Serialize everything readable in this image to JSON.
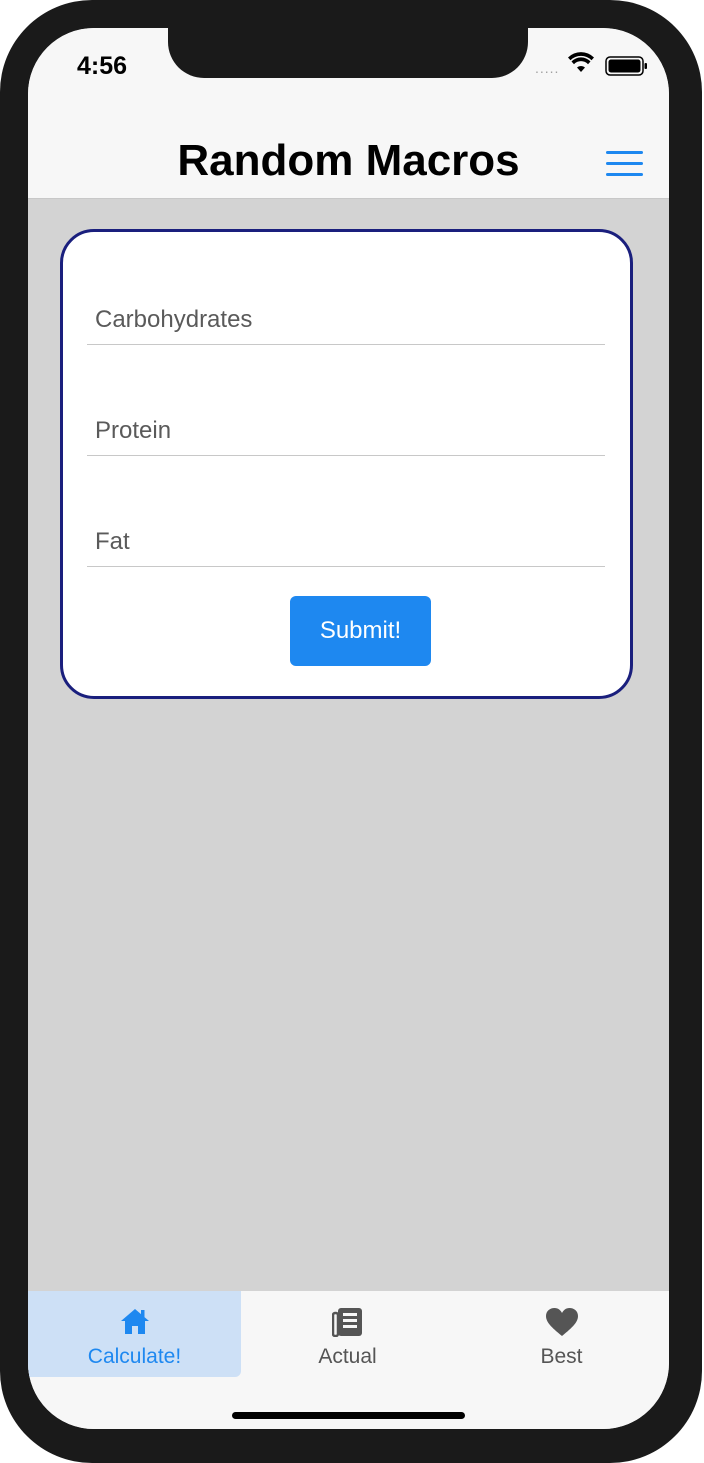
{
  "status_bar": {
    "time": "4:56",
    "signal_dots": "....."
  },
  "header": {
    "title": "Random Macros",
    "menu_icon": "hamburger-menu-icon"
  },
  "form": {
    "carbs_placeholder": "Carbohydrates",
    "protein_placeholder": "Protein",
    "fat_placeholder": "Fat",
    "submit_label": "Submit!"
  },
  "tabs": [
    {
      "label": "Calculate!",
      "icon": "home-icon",
      "active": true
    },
    {
      "label": "Actual",
      "icon": "newspaper-icon",
      "active": false
    },
    {
      "label": "Best",
      "icon": "heart-icon",
      "active": false
    }
  ],
  "colors": {
    "accent": "#1e88f0",
    "card_border": "#1a1f7d",
    "background": "#d3d3d3",
    "active_tab_bg": "#cde0f6"
  }
}
